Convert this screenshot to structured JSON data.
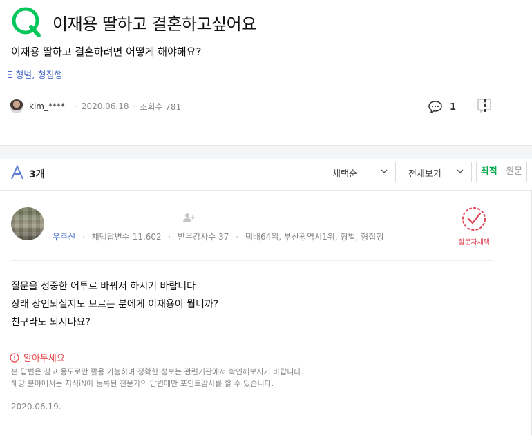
{
  "question": {
    "title": "이재용 딸하고 결혼하고싶어요",
    "body": "이재용 딸하고 결혼하려면 어떻게 해야해요?",
    "tags": "Ξ 형벌, 형집행",
    "author": "kim_****",
    "date": "2020.06.18",
    "views_label": "조회수 781",
    "comment_count": "1"
  },
  "answers_header": {
    "count_label": "3개",
    "sort_label": "채택순",
    "filter_label": "전체보기",
    "toggle_recent": "최적",
    "toggle_original": "원문"
  },
  "answer": {
    "nickname": "우주신",
    "adoptions": "채택답변수 11,602",
    "thanks": "받은감사수 37",
    "ranks": "택배64위, 부산광역시1위, 형벌, 형집행",
    "chosen_label": "질문자채택",
    "lines": [
      "질문을 정중한 어투로 바꿔서 하시기 바랍니다",
      "장래 장인되실지도 모르는 분에게 이재용이 뭡니까?",
      "친구라도 되시나요?"
    ],
    "notice_title": "알아두세요",
    "notice_lines": [
      "본 답변은 참고 용도로만 활용 가능하며 정확한 정보는 관련기관에서 확인해보시기 바랍니다.",
      "해당 분야에서는 지식iN에 등록된 전문가의 답변에만 포인트감사를 할 수 있습니다."
    ],
    "date": "2020.06.19."
  },
  "colors": {
    "brand_green": "#03c75a",
    "link_blue": "#4a6cc6",
    "warning_red": "#e5484d"
  },
  "icons": [
    "q-logo-icon",
    "avatar",
    "comment-icon",
    "report-icon",
    "more-icon",
    "answer-a-icon",
    "chevron-down-icon",
    "add-friend-icon",
    "chosen-check-icon",
    "alert-icon"
  ]
}
